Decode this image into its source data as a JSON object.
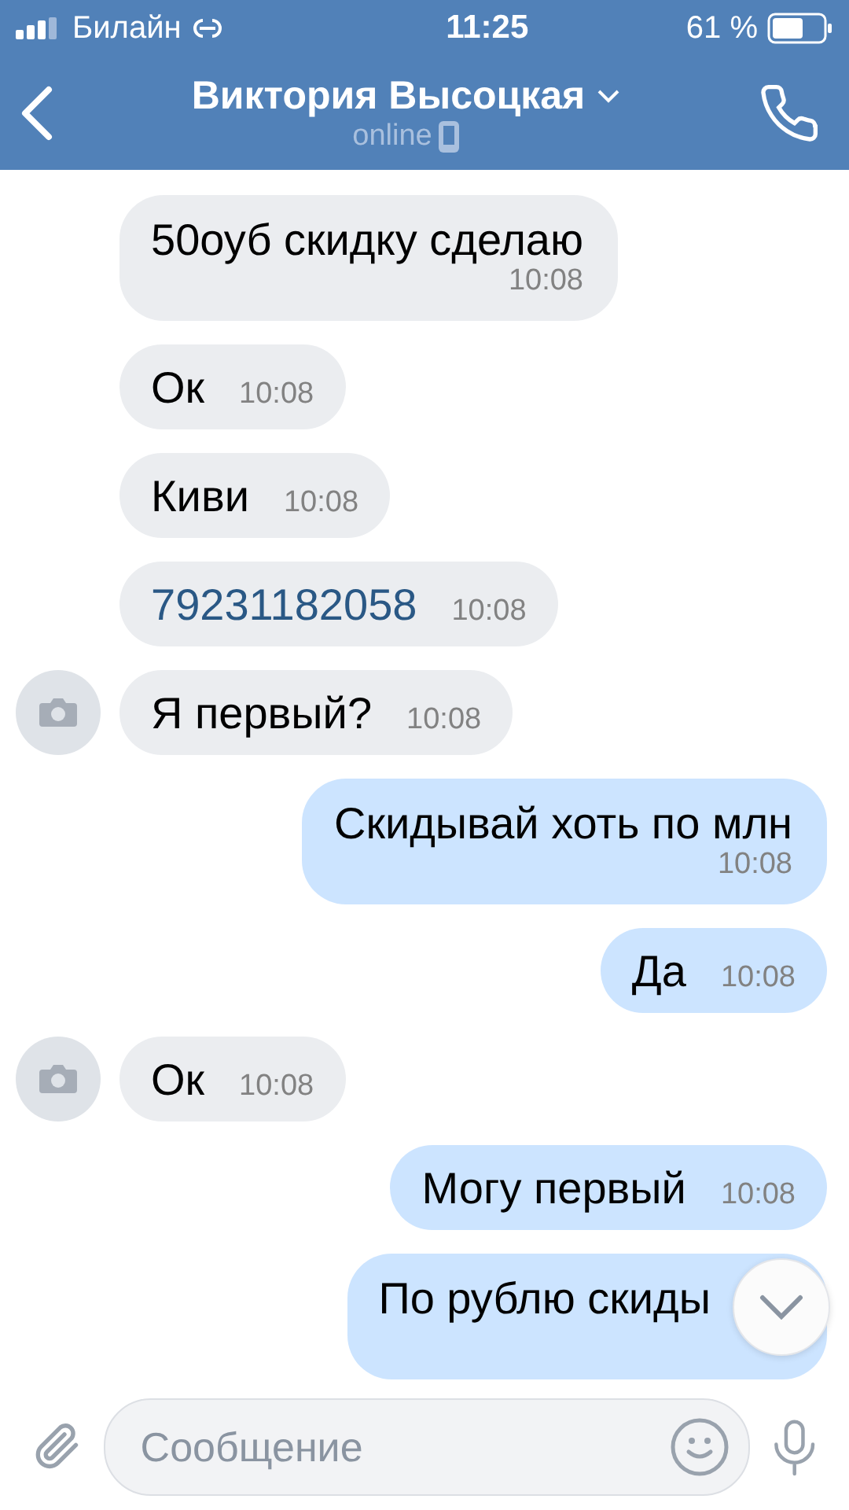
{
  "status_bar": {
    "carrier": "Билайн",
    "time": "11:25",
    "battery": "61 %"
  },
  "header": {
    "title": "Виктория Высоцкая",
    "status": "online"
  },
  "messages": [
    {
      "kind": "incoming",
      "link": false,
      "time_below": true,
      "avatar": false,
      "text": "50оуб скидку сделаю",
      "time": "10:08"
    },
    {
      "kind": "incoming",
      "link": false,
      "time_below": false,
      "avatar": false,
      "text": "Ок",
      "time": "10:08"
    },
    {
      "kind": "incoming",
      "link": false,
      "time_below": false,
      "avatar": false,
      "text": "Киви",
      "time": "10:08"
    },
    {
      "kind": "incoming",
      "link": true,
      "time_below": false,
      "avatar": false,
      "text": "79231182058",
      "time": "10:08"
    },
    {
      "kind": "incoming",
      "link": false,
      "time_below": false,
      "avatar": true,
      "text": "Я первый?",
      "time": "10:08"
    },
    {
      "kind": "outgoing",
      "link": false,
      "time_below": true,
      "text": "Скидывай хоть по млн",
      "time": "10:08"
    },
    {
      "kind": "outgoing",
      "link": false,
      "time_below": false,
      "text": "Да",
      "time": "10:08"
    },
    {
      "kind": "incoming",
      "link": false,
      "time_below": false,
      "avatar": true,
      "text": "Ок",
      "time": "10:08"
    },
    {
      "kind": "outgoing",
      "link": false,
      "time_below": false,
      "text": "Могу первый",
      "time": "10:08"
    },
    {
      "kind": "outgoing",
      "link": false,
      "time_below": true,
      "under_scroll_button": true,
      "text": "По рублю скиды"
    }
  ],
  "composer": {
    "placeholder": "Сообщение"
  }
}
